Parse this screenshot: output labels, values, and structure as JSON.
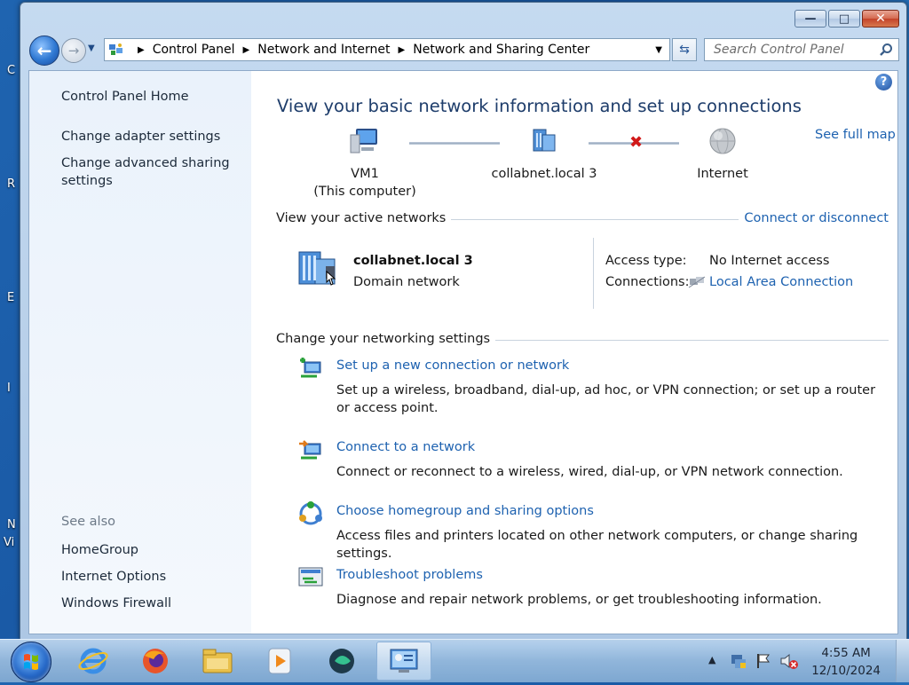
{
  "window": {
    "controls": {
      "minimize": "—",
      "maximize": "□",
      "close": "✕"
    }
  },
  "navbar": {
    "breadcrumbs": [
      "Control Panel",
      "Network and Internet",
      "Network and Sharing Center"
    ],
    "search_placeholder": "Search Control Panel"
  },
  "sidebar": {
    "links": [
      "Control Panel Home",
      "Change adapter settings",
      "Change advanced sharing settings"
    ],
    "see_also_label": "See also",
    "see_also": [
      "HomeGroup",
      "Internet Options",
      "Windows Firewall"
    ]
  },
  "main": {
    "title": "View your basic network information and set up connections",
    "see_full_map": "See full map",
    "map": {
      "computer_name": "VM1",
      "computer_sub": "(This computer)",
      "network": "collabnet.local  3",
      "internet": "Internet"
    },
    "active_networks": {
      "heading": "View your active networks",
      "connect_link": "Connect or disconnect",
      "name": "collabnet.local  3",
      "type": "Domain network",
      "access_type_label": "Access type:",
      "access_type_value": "No Internet access",
      "connections_label": "Connections:",
      "connections_value": "Local Area Connection"
    },
    "settings": {
      "heading": "Change your networking settings",
      "tasks": [
        {
          "link": "Set up a new connection or network",
          "desc": "Set up a wireless, broadband, dial-up, ad hoc, or VPN connection; or set up a router or access point."
        },
        {
          "link": "Connect to a network",
          "desc": "Connect or reconnect to a wireless, wired, dial-up, or VPN network connection."
        },
        {
          "link": "Choose homegroup and sharing options",
          "desc": "Access files and printers located on other network computers, or change sharing settings."
        },
        {
          "link": "Troubleshoot problems",
          "desc": "Diagnose and repair network problems, or get troubleshooting information."
        }
      ]
    }
  },
  "taskbar": {
    "apps": [
      "internet-explorer-icon",
      "firefox-icon",
      "file-explorer-icon",
      "media-player-icon",
      "app-icon",
      "control-panel-icon"
    ],
    "time": "4:55 AM",
    "date": "12/10/2024"
  },
  "desktop_edge": [
    "C",
    "R",
    "E",
    "I",
    "N",
    "Vi"
  ]
}
